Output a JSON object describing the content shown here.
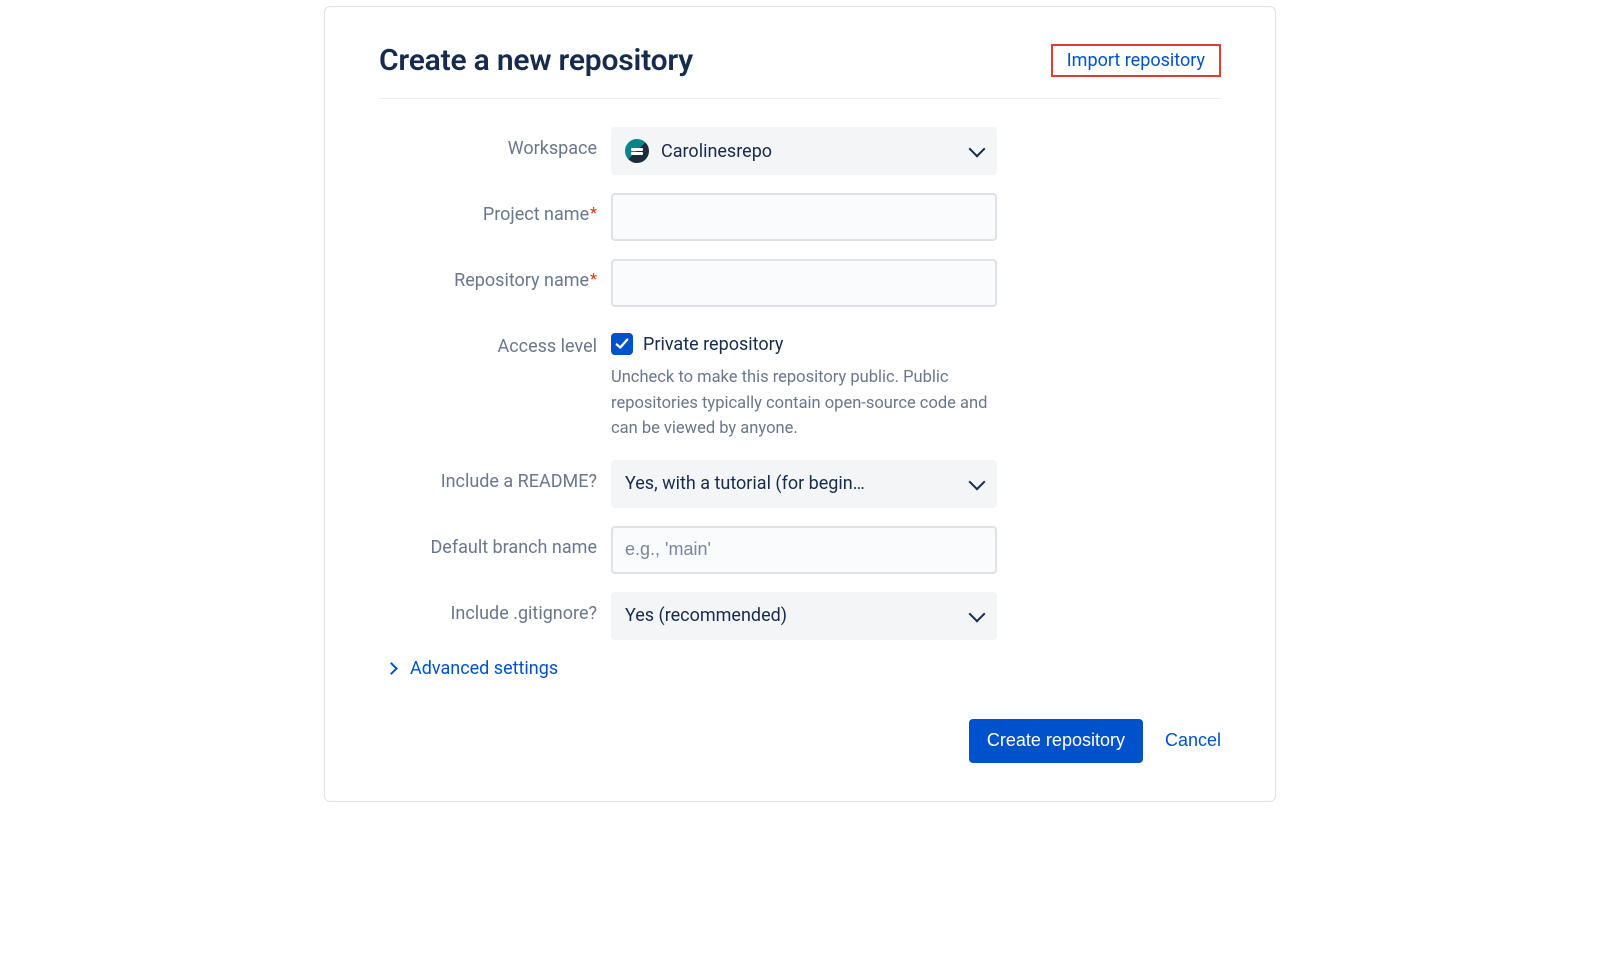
{
  "header": {
    "title": "Create a new repository",
    "import_label": "Import repository"
  },
  "form": {
    "workspace": {
      "label": "Workspace",
      "value": "Carolinesrepo"
    },
    "project_name": {
      "label": "Project name",
      "value": ""
    },
    "repository_name": {
      "label": "Repository name",
      "value": ""
    },
    "access_level": {
      "label": "Access level",
      "checkbox_label": "Private repository",
      "checked": true,
      "help": "Uncheck to make this repository public. Public repositories typically contain open-source code and can be viewed by anyone."
    },
    "include_readme": {
      "label": "Include a README?",
      "value": "Yes, with a tutorial (for begin…"
    },
    "default_branch": {
      "label": "Default branch name",
      "placeholder": "e.g., 'main'",
      "value": ""
    },
    "include_gitignore": {
      "label": "Include .gitignore?",
      "value": "Yes (recommended)"
    },
    "advanced_label": "Advanced settings"
  },
  "actions": {
    "submit": "Create repository",
    "cancel": "Cancel"
  }
}
